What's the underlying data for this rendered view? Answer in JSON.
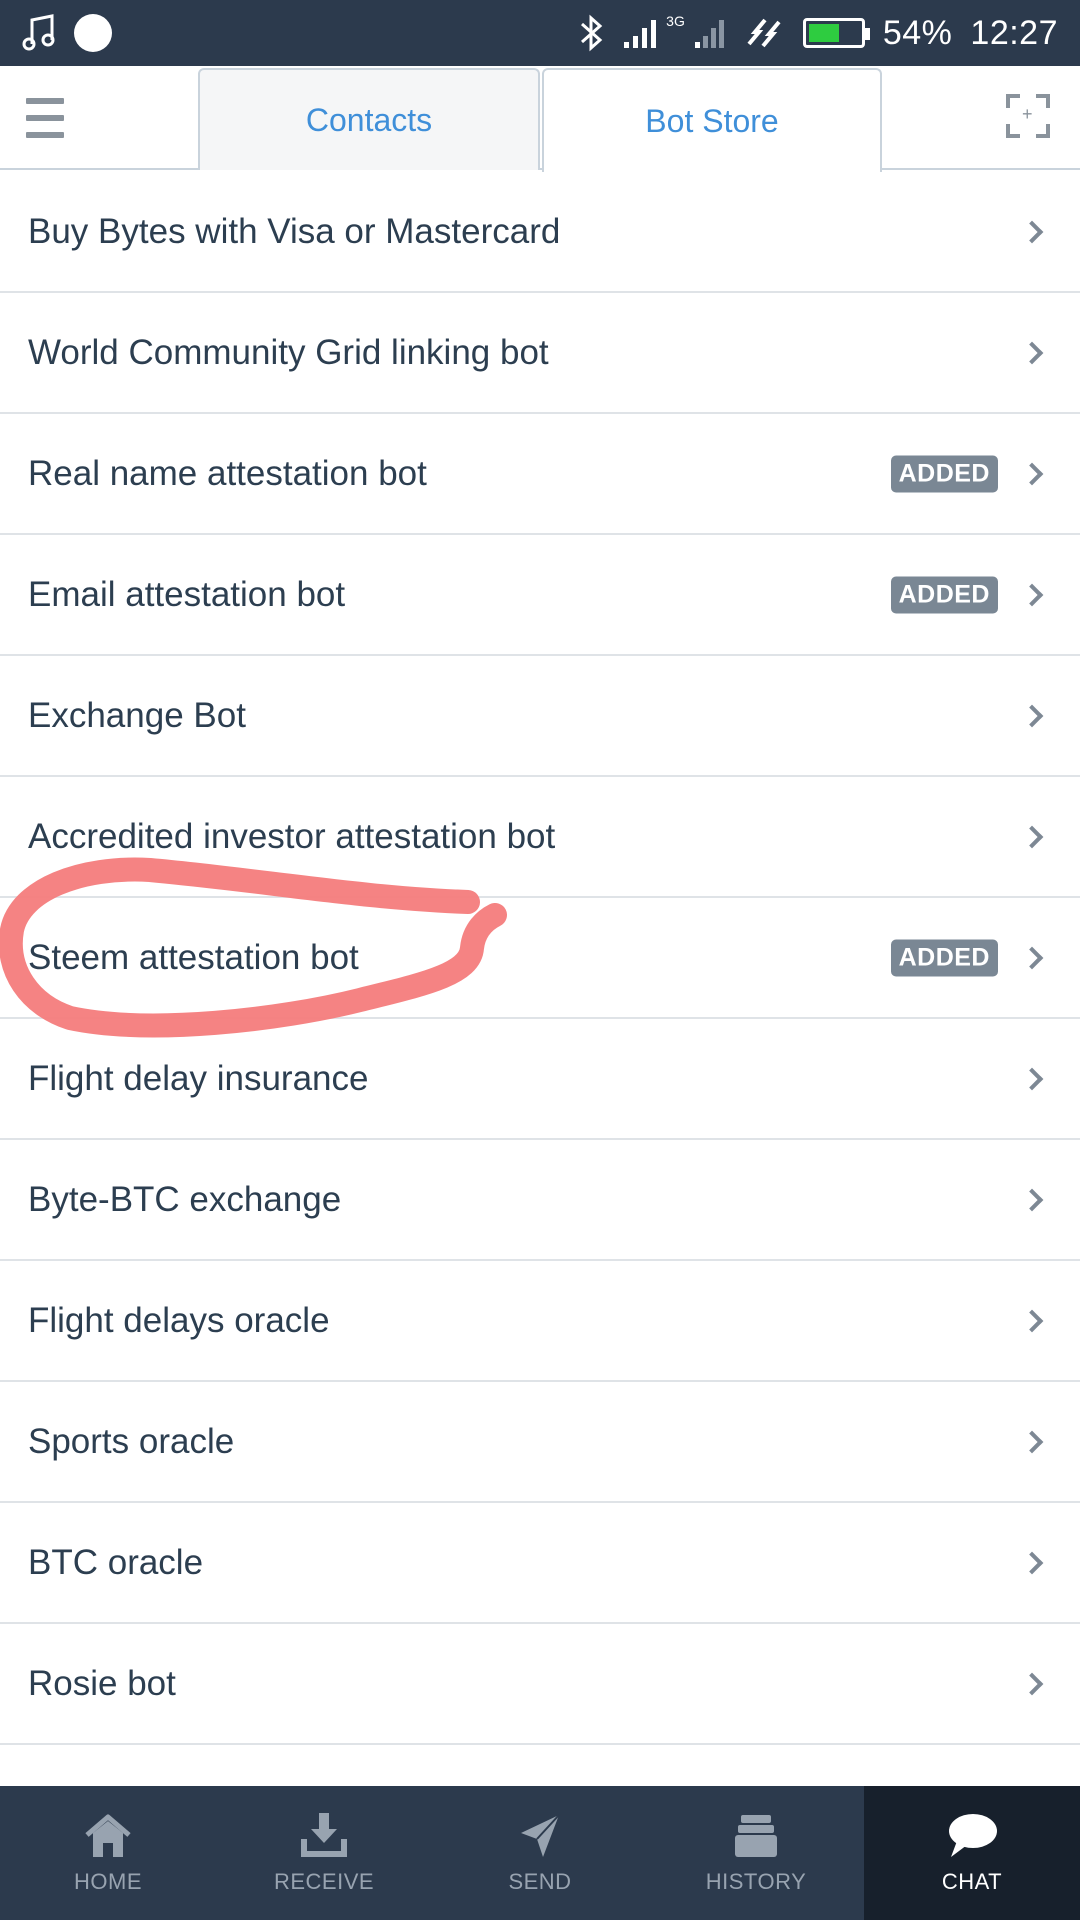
{
  "status_bar": {
    "battery": "54%",
    "time": "12:27",
    "network_label": "3G"
  },
  "tabs": [
    {
      "label": "Contacts",
      "active": false
    },
    {
      "label": "Bot Store",
      "active": true
    }
  ],
  "bots": [
    {
      "label": "Buy Bytes with Visa or Mastercard",
      "added": false
    },
    {
      "label": "World Community Grid linking bot",
      "added": false
    },
    {
      "label": "Real name attestation bot",
      "added": true
    },
    {
      "label": "Email attestation bot",
      "added": true
    },
    {
      "label": "Exchange Bot",
      "added": false
    },
    {
      "label": "Accredited investor attestation bot",
      "added": false
    },
    {
      "label": "Steem attestation bot",
      "added": true
    },
    {
      "label": "Flight delay insurance",
      "added": false
    },
    {
      "label": "Byte-BTC exchange",
      "added": false
    },
    {
      "label": "Flight delays oracle",
      "added": false
    },
    {
      "label": "Sports oracle",
      "added": false
    },
    {
      "label": "BTC oracle",
      "added": false
    },
    {
      "label": "Rosie bot",
      "added": false
    }
  ],
  "badge_label": "ADDED",
  "bottom_nav": [
    {
      "label": "HOME",
      "icon": "home-icon",
      "active": false
    },
    {
      "label": "RECEIVE",
      "icon": "receive-icon",
      "active": false
    },
    {
      "label": "SEND",
      "icon": "send-icon",
      "active": false
    },
    {
      "label": "HISTORY",
      "icon": "history-icon",
      "active": false
    },
    {
      "label": "CHAT",
      "icon": "chat-icon",
      "active": true
    }
  ],
  "colors": {
    "header_bg": "#2c3a4d",
    "accent": "#3f8fd9",
    "badge": "#7a8794",
    "annotation": "#f47c7c"
  }
}
